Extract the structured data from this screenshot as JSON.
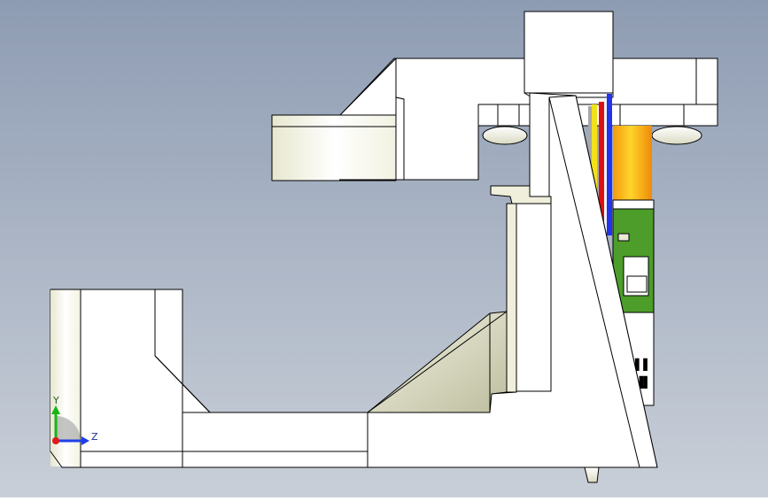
{
  "viewport": {
    "background_top": "#8e9cb3",
    "background_bottom": "#c9cfd8"
  },
  "colors": {
    "part_fill": "#ffffff",
    "part_shade": "#efefdc",
    "part_shade_dark": "#c9c9b0",
    "edge": "#000000",
    "pcb_green": "#4c9d2a",
    "cap_yellow": "#f6c21a",
    "cap_orange": "#f39a10",
    "wire_blue": "#2233ee",
    "wire_red": "#dd1111",
    "wire_yellow": "#f2e21a",
    "wire_gray": "#a8a8a8",
    "axis_y": "#16b516",
    "axis_z": "#1f3fe8",
    "axis_x_origin": "#e01a1a"
  },
  "triad": {
    "y_label": "Y",
    "z_label": "Z",
    "y_icon": "axis-y-arrow-icon",
    "z_icon": "axis-z-arrow-icon",
    "origin_icon": "axis-origin-icon"
  }
}
